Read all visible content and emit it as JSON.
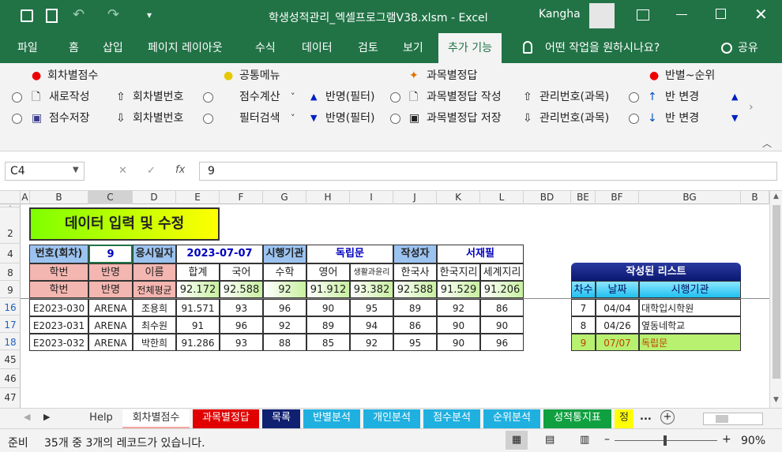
{
  "title": {
    "text": "학생성적관리_엑셀프로그램V38.xlsm  -  Excel",
    "user": "Kangha"
  },
  "menus": [
    "파일",
    "홈",
    "삽입",
    "페이지 레이아웃",
    "수식",
    "데이터",
    "검토",
    "보기",
    "추가 기능"
  ],
  "tellme": "어떤 작업을 원하시나요?",
  "share": "공유",
  "ribbon": {
    "g1": "회차별점수",
    "g2": "공통메뉴",
    "g3": "과목별정답",
    "g4": "반별~순위",
    "new": "새로작성",
    "save": "점수저장",
    "up1": "회차별번호",
    "down1": "회차별번호",
    "calc": "점수계산",
    "filter": "필터검색",
    "banf1": "반명(필터)",
    "banf2": "반명(필터)",
    "ans_new": "과목별정답 작성",
    "ans_save": "과목별정답 저장",
    "mgr1": "관리번호(과목)",
    "mgr2": "관리번호(과목)",
    "ch1": "반 변경",
    "ch2": "반 변경"
  },
  "formula": {
    "namebox": "C4",
    "fx": "fx",
    "value": "9"
  },
  "columns": [
    "A",
    "B",
    "C",
    "D",
    "E",
    "F",
    "G",
    "H",
    "I",
    "J",
    "K",
    "L",
    "BD",
    "BE",
    "BF",
    "BG",
    "B"
  ],
  "rows": [
    "1",
    "2",
    "4",
    "8",
    "9",
    "16",
    "17",
    "18",
    "45",
    "46",
    "47"
  ],
  "banner": "데이터 입력 및 수정",
  "info": {
    "l1": "번호(회차)",
    "v1": "9",
    "l2": "응시일자",
    "v2": "2023-07-07",
    "l3": "시행기관",
    "v3": "독립문",
    "l4": "작성자",
    "v4": "서재필"
  },
  "header1": [
    "학번",
    "반명",
    "이름",
    "합계",
    "국어",
    "수학",
    "영어",
    "생활과윤리",
    "한국사",
    "한국지리",
    "세계지리"
  ],
  "header2": [
    "학번",
    "반명",
    "전체평균",
    "92.172",
    "92.588",
    "92",
    "91.912",
    "93.382",
    "92.588",
    "91.529",
    "91.206"
  ],
  "table": [
    [
      "E2023-030",
      "ARENA",
      "조용희",
      "91.571",
      "93",
      "96",
      "90",
      "95",
      "89",
      "92",
      "86"
    ],
    [
      "E2023-031",
      "ARENA",
      "최수원",
      "91",
      "96",
      "92",
      "89",
      "94",
      "86",
      "90",
      "90"
    ],
    [
      "E2023-032",
      "ARENA",
      "박한희",
      "91.286",
      "93",
      "88",
      "85",
      "92",
      "95",
      "90",
      "96"
    ]
  ],
  "list": {
    "title": "작성된 리스트",
    "headers": [
      "차수",
      "날짜",
      "시행기관"
    ],
    "rows": [
      [
        "7",
        "04/04",
        "대학입시학원"
      ],
      [
        "8",
        "04/26",
        "옆동네학교"
      ],
      [
        "9",
        "07/07",
        "독립문"
      ]
    ]
  },
  "tabs": [
    "Help",
    "회차별점수",
    "과목별정답",
    "목록",
    "반별분석",
    "개인분석",
    "점수분석",
    "순위분석",
    "성적통지표",
    "정"
  ],
  "status": {
    "ready": "준비",
    "msg": "35개 중 3개의 레코드가 있습니다.",
    "zoom": "90%"
  },
  "colors": {
    "excel": "#217346",
    "banner": "#7fff00",
    "hdr": "#9cc3f0"
  }
}
